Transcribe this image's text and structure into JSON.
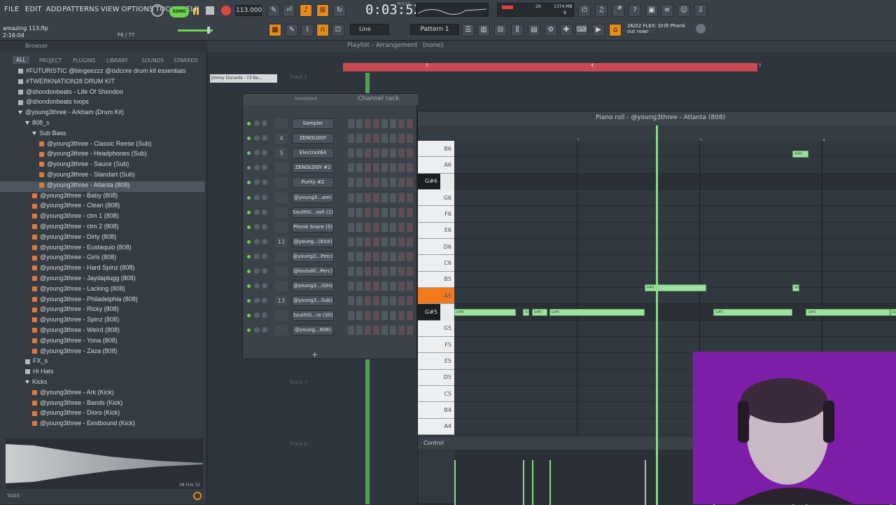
{
  "menu": [
    "FILE",
    "EDIT",
    "ADD",
    "PATTERNS",
    "VIEW",
    "OPTIONS",
    "TOOLS",
    "HELP"
  ],
  "song": {
    "name": "amazing 113.flp",
    "time_pos": "2:16:04",
    "counter": "F6 / 77"
  },
  "transport": {
    "song_label": "SONG",
    "tempo": "113.000",
    "time": "0:03:52",
    "time_unit": "M:S:CS"
  },
  "resources": {
    "memory": "1374 MB",
    "cpu": "29",
    "voices": "8"
  },
  "snap": {
    "mode": "Line",
    "pattern": "Pattern 1"
  },
  "news": {
    "date": "26/02",
    "text": "FLEX: Drift Phonk out now!"
  },
  "browser": {
    "title": "Browser",
    "tabs": [
      "ALL",
      "PROJECT",
      "PLUGINS",
      "LIBRARY",
      "SOUNDS",
      "STARRED"
    ],
    "tags_label": "TAGS",
    "sample_info": "48 kHz 32",
    "items": [
      {
        "label": "#FUTURISTIC @bingeezzz @isdcore drum kit essentials",
        "type": "folder",
        "indent": 1
      },
      {
        "label": "#TWERKNATION28 DRUM KIT",
        "type": "folder",
        "indent": 1
      },
      {
        "label": "@shondonbeats - Life Of Shondon",
        "type": "folder",
        "indent": 1
      },
      {
        "label": "@shondonbeats loops",
        "type": "folder",
        "indent": 1
      },
      {
        "label": "@young3three - Arkham (Drum Kit)",
        "type": "open",
        "indent": 1
      },
      {
        "label": "808_s",
        "type": "open",
        "indent": 2
      },
      {
        "label": "Sub Bass",
        "type": "open",
        "indent": 3
      },
      {
        "label": "@young3three - Classic Reese (Sub)",
        "type": "file",
        "indent": 4
      },
      {
        "label": "@young3three - Headphones (Sub)",
        "type": "file",
        "indent": 4
      },
      {
        "label": "@young3three - Sauce (Sub)",
        "type": "file",
        "indent": 4
      },
      {
        "label": "@young3three - Standart (Sub)",
        "type": "file",
        "indent": 4
      },
      {
        "label": "@young3three - Atlanta (808)",
        "type": "file",
        "indent": 4
      },
      {
        "label": "@young3three - Baby (808)",
        "type": "file",
        "indent": 3
      },
      {
        "label": "@young3three - Clean (808)",
        "type": "file",
        "indent": 3
      },
      {
        "label": "@young3three - ctm 1 (808)",
        "type": "file",
        "indent": 3
      },
      {
        "label": "@young3three - ctm 2 (808)",
        "type": "file",
        "indent": 3
      },
      {
        "label": "@young3three - Dirty (808)",
        "type": "file",
        "indent": 3
      },
      {
        "label": "@young3three - Eustaquio (808)",
        "type": "file",
        "indent": 3
      },
      {
        "label": "@young3three - Girls (808)",
        "type": "file",
        "indent": 3
      },
      {
        "label": "@young3three - Hard Spinz (808)",
        "type": "file",
        "indent": 3
      },
      {
        "label": "@young3three - Jaydaplugg (808)",
        "type": "file",
        "indent": 3
      },
      {
        "label": "@young3three - Lacking (808)",
        "type": "file",
        "indent": 3
      },
      {
        "label": "@young3three - Philadelphia (808)",
        "type": "file",
        "indent": 3
      },
      {
        "label": "@young3three - Ricky (808)",
        "type": "file",
        "indent": 3
      },
      {
        "label": "@young3three - Spinz (808)",
        "type": "file",
        "indent": 3
      },
      {
        "label": "@young3three - Weird (808)",
        "type": "file",
        "indent": 3
      },
      {
        "label": "@young3three - Yona (808)",
        "type": "file",
        "indent": 3
      },
      {
        "label": "@young3three - Zaza (808)",
        "type": "file",
        "indent": 3
      },
      {
        "label": "FX_s",
        "type": "folder",
        "indent": 2
      },
      {
        "label": "Hi Hats",
        "type": "folder",
        "indent": 2
      },
      {
        "label": "Kicks",
        "type": "open",
        "indent": 2
      },
      {
        "label": "@young3three - Ark (Kick)",
        "type": "file",
        "indent": 3
      },
      {
        "label": "@young3three - Bands (Kick)",
        "type": "file",
        "indent": 3
      },
      {
        "label": "@young3three - Dioro (Kick)",
        "type": "file",
        "indent": 3
      },
      {
        "label": "@young3three - Eestbound (Kick)",
        "type": "file",
        "indent": 3
      }
    ]
  },
  "playlist": {
    "title": "Playlist - Arrangement",
    "pattern": "(none)",
    "track1": "Track 1",
    "track7": "Track 7",
    "track8": "Track 8",
    "clip": "Jimmy Durante - I'll Be..."
  },
  "channel_rack": {
    "title": "Channel rack",
    "group": "Unsorted",
    "channels": [
      {
        "num": "",
        "name": "Sampler"
      },
      {
        "num": "4",
        "name": "ZENOLOGY"
      },
      {
        "num": "5",
        "name": "ElectraX64"
      },
      {
        "num": "",
        "name": "ZENOLOGY #2"
      },
      {
        "num": "",
        "name": "Purity #2"
      },
      {
        "num": "",
        "name": "@young3...are)"
      },
      {
        "num": "",
        "name": "SouthSi...ash (1)"
      },
      {
        "num": "",
        "name": "Phonk Snare (5)"
      },
      {
        "num": "12",
        "name": "@young...(Kick)"
      },
      {
        "num": "",
        "name": "@young3...Perc)"
      },
      {
        "num": "",
        "name": "@louisdif...Perc)"
      },
      {
        "num": "",
        "name": "@young3...(OH)"
      },
      {
        "num": "13",
        "name": "@young3...Sub)"
      },
      {
        "num": "",
        "name": "SouthSi...re (30)"
      },
      {
        "num": "",
        "name": "@young...808)"
      }
    ]
  },
  "piano_roll": {
    "title": "Piano roll - @young3three - Atlanta (808)",
    "bars": [
      "2",
      "3",
      "4"
    ],
    "keys": [
      "B6",
      "A6",
      "G#6",
      "G6",
      "F6",
      "E6",
      "D6",
      "C6",
      "B5",
      "A5",
      "G#5",
      "G5",
      "F5",
      "E5",
      "D5",
      "C5",
      "B4",
      "A4"
    ],
    "control_label": "Control",
    "notes": [
      {
        "label": "G#5",
        "start": 0.0,
        "len": 0.14
      },
      {
        "label": "G#5",
        "start": 0.155,
        "len": 0.015
      },
      {
        "label": "G#5",
        "start": 0.175,
        "len": 0.035
      },
      {
        "label": "G#5",
        "start": 0.215,
        "len": 0.215
      },
      {
        "label": "G#5",
        "start": 0.585,
        "len": 0.18
      },
      {
        "label": "G#5",
        "start": 0.795,
        "len": 0.19
      },
      {
        "label": "G#5",
        "start": 0.985,
        "len": 0.015
      },
      {
        "label": "A#5",
        "start": 0.43,
        "len": 0.14
      },
      {
        "label": "A#5",
        "start": 0.765,
        "len": 0.015
      },
      {
        "label": "A#6",
        "start": 0.765,
        "len": 0.035
      }
    ]
  },
  "playlist_bars": [
    "3",
    "4",
    "5"
  ]
}
